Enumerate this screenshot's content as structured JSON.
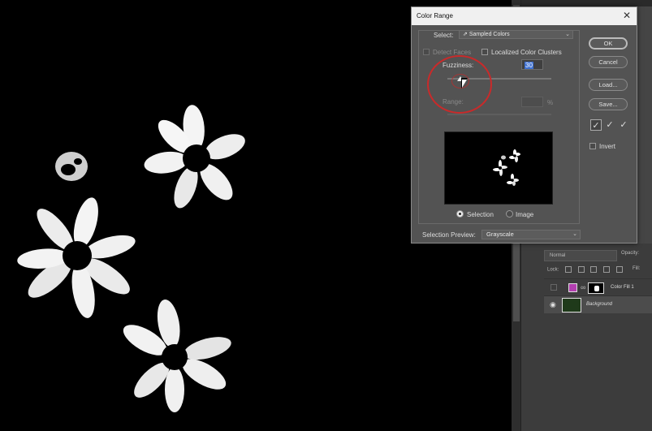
{
  "dialog": {
    "title": "Color Range",
    "select_label": "Select:",
    "select_value": "Sampled Colors",
    "detect_faces_label": "Detect Faces",
    "localized_clusters_label": "Localized Color Clusters",
    "fuzziness_label": "Fuzziness:",
    "fuzziness_value": "30",
    "range_label": "Range:",
    "range_unit": "%",
    "radio_selection_label": "Selection",
    "radio_image_label": "Image",
    "selection_preview_label": "Selection Preview:",
    "selection_preview_value": "Grayscale",
    "ok_label": "OK",
    "cancel_label": "Cancel",
    "load_label": "Load...",
    "save_label": "Save...",
    "invert_label": "Invert",
    "dropper_icons": [
      "eyedropper-icon",
      "eyedropper-plus-icon",
      "eyedropper-minus-icon"
    ]
  },
  "layers": {
    "blend_mode": "Normal",
    "opacity_label": "Opacity:",
    "lock_label": "Lock:",
    "fill_label": "Fill:",
    "items": [
      {
        "name": "Color Fill 1",
        "swatch_color": "#b33fb0"
      },
      {
        "name": "Background"
      }
    ]
  },
  "colors": {
    "annotation": "#c92a2a",
    "highlight": "#3d6fd0",
    "dialog_bg": "#535353"
  }
}
